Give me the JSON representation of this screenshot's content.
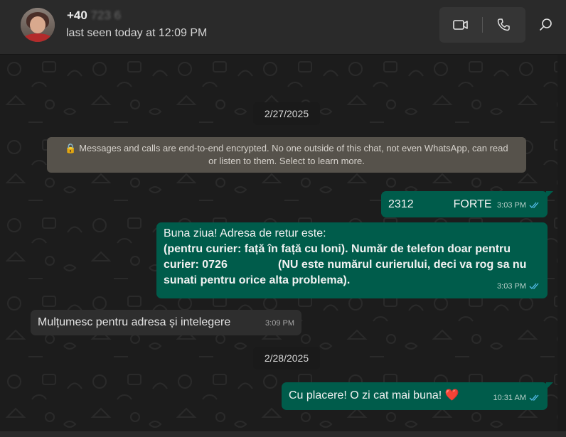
{
  "header": {
    "contact_prefix": "+40",
    "contact_blurred": "723 6",
    "status": "last seen today at 12:09 PM"
  },
  "chat": {
    "date_1": "2/27/2025",
    "encryption_notice_line1": "🔒 Messages and calls are end-to-end encrypted. No one outside of this chat, not even WhatsApp, can read",
    "encryption_notice_line2": "or listen to them. Select to learn more.",
    "msg1": {
      "text_a": "2312",
      "text_b": "FORTE",
      "time": "3:03 PM"
    },
    "msg2": {
      "line1": "Buna ziua! Adresa de retur este:",
      "line2": "(pentru curier: față în față cu Ioni). Număr de telefon doar pentru",
      "line3_a": "curier: 0726",
      "line3_b": "(NU este numărul curierului, deci va rog sa nu",
      "line4": "sunati pentru orice alta problema).",
      "time": "3:03 PM"
    },
    "msg3": {
      "text": "Mulțumesc pentru adresa și intelegere",
      "time": "3:09 PM"
    },
    "date_2": "2/28/2025",
    "msg4": {
      "text": "Cu placere! O zi cat mai buna! ❤️",
      "time": "10:31 AM"
    }
  },
  "colors": {
    "outgoing_bubble": "#005c4b",
    "incoming_bubble": "#2e2e2e",
    "read_ticks": "#53bdeb"
  }
}
